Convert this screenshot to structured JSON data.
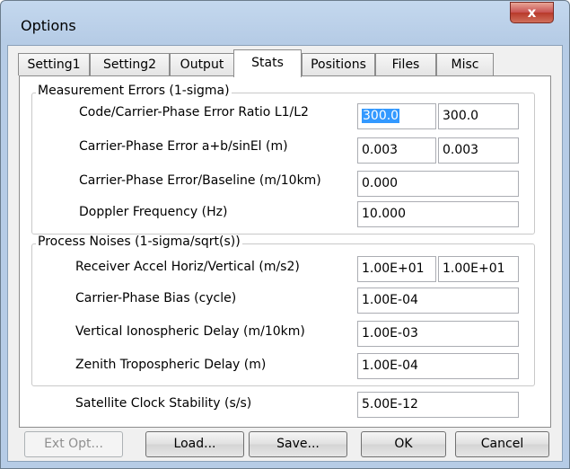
{
  "window": {
    "title": "Options",
    "close_glyph": "x"
  },
  "tabs": [
    {
      "label": "Setting1"
    },
    {
      "label": "Setting2"
    },
    {
      "label": "Output"
    },
    {
      "label": "Stats"
    },
    {
      "label": "Positions"
    },
    {
      "label": "Files"
    },
    {
      "label": "Misc"
    }
  ],
  "measurement": {
    "title": "Measurement Errors (1-sigma)",
    "code_carrier_label": "Code/Carrier-Phase Error Ratio L1/L2",
    "code_carrier_l1": "300.0",
    "code_carrier_l2": "300.0",
    "carrier_phase_label": "Carrier-Phase Error a+b/sinEl (m)",
    "carrier_phase_a": "0.003",
    "carrier_phase_b": "0.003",
    "baseline_label": "Carrier-Phase Error/Baseline (m/10km)",
    "baseline": "0.000",
    "doppler_label": "Doppler Frequency (Hz)",
    "doppler": "10.000"
  },
  "noise": {
    "title": "Process Noises (1-sigma/sqrt(s))",
    "accel_label": "Receiver Accel Horiz/Vertical (m/s2)",
    "accel_horiz": "1.00E+01",
    "accel_vert": "1.00E+01",
    "bias_label": "Carrier-Phase Bias (cycle)",
    "bias": "1.00E-04",
    "iono_label": "Vertical Ionospheric Delay (m/10km)",
    "iono": "1.00E-03",
    "tropo_label": "Zenith Tropospheric Delay (m)",
    "tropo": "1.00E-04"
  },
  "clock": {
    "label": "Satellite Clock Stability (s/s)",
    "value": "5.00E-12"
  },
  "buttons": {
    "ext_opt": "Ext Opt...",
    "load": "Load...",
    "save": "Save...",
    "ok": "OK",
    "cancel": "Cancel"
  }
}
